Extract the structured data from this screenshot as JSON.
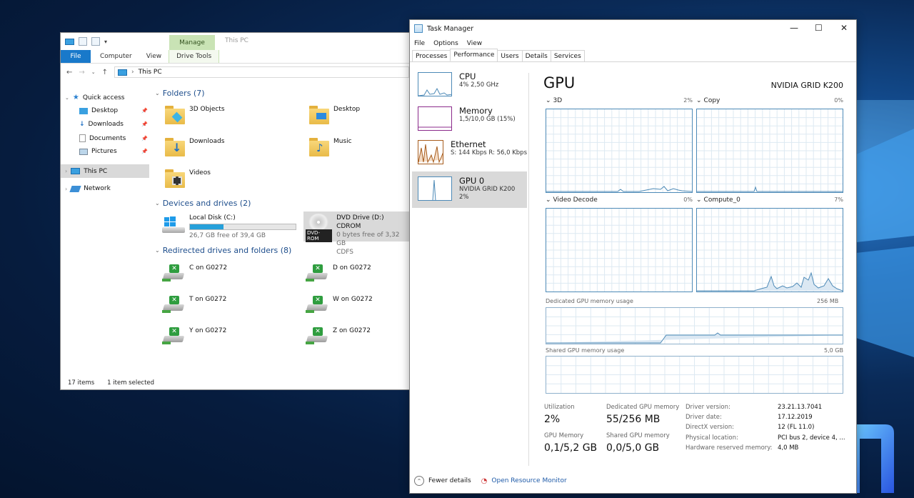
{
  "explorer": {
    "title": "This PC",
    "manage_tab": "Manage",
    "ribbon": {
      "file": "File",
      "computer": "Computer",
      "view": "View",
      "drive_tools": "Drive Tools"
    },
    "address": "This PC",
    "nav": {
      "quick_access": "Quick access",
      "items": [
        "Desktop",
        "Downloads",
        "Documents",
        "Pictures"
      ],
      "this_pc": "This PC",
      "network": "Network"
    },
    "folders_header": "Folders (7)",
    "folders": [
      "3D Objects",
      "Desktop",
      "Downloads",
      "Music",
      "Videos"
    ],
    "devices_header": "Devices and drives (2)",
    "local_disk": {
      "name": "Local Disk (C:)",
      "free": "26,7 GB free of 39,4 GB",
      "used_fraction": 0.32
    },
    "dvd": {
      "name": "DVD Drive (D:) CDROM",
      "free": "0 bytes free of 3,32 GB",
      "fs": "CDFS",
      "badge": "DVD-ROM"
    },
    "redirected_header": "Redirected drives and folders (8)",
    "redirected": [
      "C on G0272",
      "D on G0272",
      "T on G0272",
      "W on G0272",
      "Y on G0272",
      "Z on G0272"
    ],
    "status": {
      "items": "17 items",
      "selected": "1 item selected"
    }
  },
  "taskmgr": {
    "title": "Task Manager",
    "menu": [
      "File",
      "Options",
      "View"
    ],
    "tabs": [
      "Processes",
      "Performance",
      "Users",
      "Details",
      "Services"
    ],
    "active_tab": "Performance",
    "resources": [
      {
        "name": "CPU",
        "detail": "4% 2,50 GHz"
      },
      {
        "name": "Memory",
        "detail": "1,5/10,0 GB (15%)"
      },
      {
        "name": "Ethernet",
        "detail": "S: 144 Kbps R: 56,0 Kbps"
      },
      {
        "name": "GPU 0",
        "detail": "NVIDIA GRID K200",
        "detail2": "2%"
      }
    ],
    "gpu_title": "GPU",
    "gpu_model": "NVIDIA GRID K200",
    "engines": [
      {
        "name": "3D",
        "pct": "2%"
      },
      {
        "name": "Copy",
        "pct": "0%"
      },
      {
        "name": "Video Decode",
        "pct": "0%"
      },
      {
        "name": "Compute_0",
        "pct": "7%"
      }
    ],
    "dedicated_label": "Dedicated GPU memory usage",
    "dedicated_max": "256 MB",
    "shared_label": "Shared GPU memory usage",
    "shared_max": "5,0 GB",
    "stats": {
      "utilization_k": "Utilization",
      "utilization_v": "2%",
      "dedicated_k": "Dedicated GPU memory",
      "dedicated_v": "55/256 MB",
      "gpu_mem_k": "GPU Memory",
      "gpu_mem_v": "0,1/5,2 GB",
      "shared_k": "Shared GPU memory",
      "shared_v": "0,0/5,0 GB"
    },
    "driver": [
      {
        "k": "Driver version:",
        "v": "23.21.13.7041"
      },
      {
        "k": "Driver date:",
        "v": "17.12.2019"
      },
      {
        "k": "DirectX version:",
        "v": "12 (FL 11.0)"
      },
      {
        "k": "Physical location:",
        "v": "PCI bus 2, device 4, ..."
      },
      {
        "k": "Hardware reserved memory:",
        "v": "4,0 MB"
      }
    ],
    "footer": {
      "fewer": "Fewer details",
      "resmon": "Open Resource Monitor"
    },
    "window_controls": {
      "minimize": "—",
      "maximize": "☐",
      "close": "✕"
    }
  },
  "colors": {
    "accent": "#1979ca",
    "graph_line": "#4d8ab7",
    "memory": "#8b2a8b",
    "ethernet": "#a75d1e",
    "manage": "#c9e3b5"
  }
}
